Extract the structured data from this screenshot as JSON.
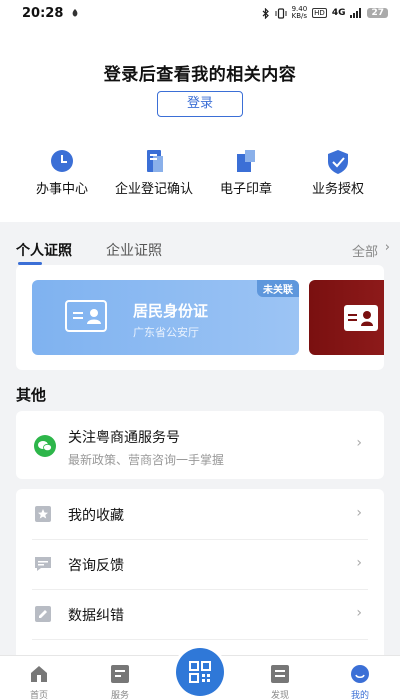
{
  "status_bar": {
    "time": "20:28",
    "network_speed_value": "9.40",
    "network_speed_unit": "KB/s",
    "hd": "HD",
    "signal": "4G",
    "battery": "27"
  },
  "login": {
    "prompt": "登录后查看我的相关内容",
    "button_label": "登录"
  },
  "services": [
    {
      "label": "办事中心",
      "icon": "clock-icon"
    },
    {
      "label": "企业登记确认",
      "icon": "document-icon"
    },
    {
      "label": "电子印章",
      "icon": "seal-icon"
    },
    {
      "label": "业务授权",
      "icon": "shield-check-icon"
    }
  ],
  "certificates": {
    "tabs": [
      "个人证照",
      "企业证照"
    ],
    "view_all": "全部",
    "card": {
      "title": "居民身份证",
      "issuer": "广东省公安厅",
      "badge": "未关联"
    }
  },
  "other": {
    "title": "其他",
    "follow": {
      "title": "关注粤商通服务号",
      "subtitle": "最新政策、营商咨询一手掌握"
    },
    "menu": [
      {
        "label": "我的收藏",
        "icon": "star-bookmark-icon"
      },
      {
        "label": "咨询反馈",
        "icon": "message-icon"
      },
      {
        "label": "数据纠错",
        "icon": "edit-icon"
      }
    ]
  },
  "tab_bar": [
    {
      "label": "首页",
      "icon": "home-icon"
    },
    {
      "label": "服务",
      "icon": "grid-icon"
    },
    {
      "label": "发现",
      "icon": "discover-icon"
    },
    {
      "label": "我的",
      "icon": "profile-icon",
      "active": true
    }
  ],
  "colors": {
    "accent": "#3b6fd6",
    "id_card": "#8ab9f2",
    "second_card": "#7a1010"
  }
}
